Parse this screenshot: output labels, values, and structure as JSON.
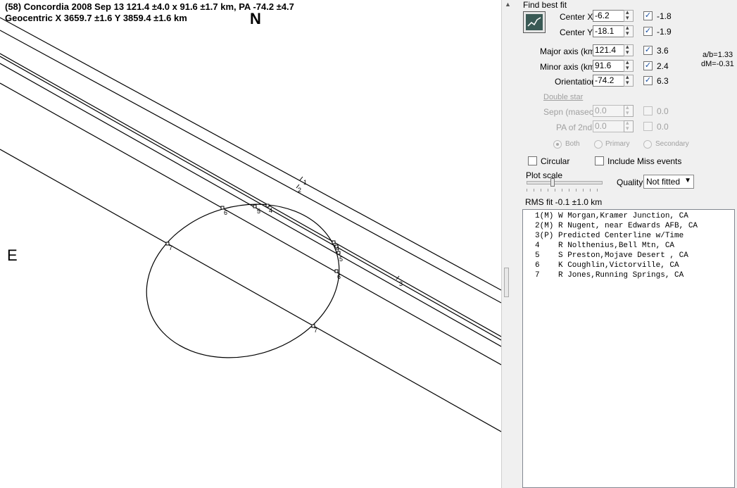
{
  "plot": {
    "title_line1": "(58) Concordia  2008 Sep 13   121.4 ±4.0 x 91.6 ±1.7 km, PA -74.2 ±4.7",
    "title_line2": "Geocentric  X  3659.7 ±1.6  Y 3859.4 ±1.6 km",
    "north_label": "N",
    "east_label": "E",
    "chord_labels": [
      "1",
      "2",
      "3",
      "4",
      "5",
      "6",
      "7"
    ]
  },
  "panel": {
    "group_title": "Find best fit",
    "center_x": {
      "label": "Center X",
      "value": "-6.2",
      "checked": true,
      "uncert": "-1.8"
    },
    "center_y": {
      "label": "Center Y",
      "value": "-18.1",
      "checked": true,
      "uncert": "-1.9"
    },
    "major": {
      "label": "Major axis (km)",
      "value": "121.4",
      "checked": true,
      "uncert": "3.6"
    },
    "minor": {
      "label": "Minor axis (km)",
      "value": "91.6",
      "checked": true,
      "uncert": "2.4"
    },
    "orient": {
      "label": "Orientation",
      "value": "-74.2",
      "checked": true,
      "uncert": "6.3"
    },
    "ratio": "a/b=1.33",
    "dm": "dM=-0.31",
    "double_star_link": "Double star",
    "sepn": {
      "label": "Sepn (masec)",
      "value": "0.0",
      "uncert": "0.0"
    },
    "pa2": {
      "label": "PA of 2nd",
      "value": "0.0",
      "uncert": "0.0"
    },
    "radio_both": "Both",
    "radio_primary": "Primary",
    "radio_secondary": "Secondary",
    "circular": "Circular",
    "include_miss": "Include Miss events",
    "plot_scale": "Plot scale",
    "quality_label": "Quality",
    "quality_value": "Not fitted",
    "rms": "RMS fit -0.1 ±1.0 km",
    "observers": [
      "1(M) W Morgan,Kramer Junction, CA",
      "2(M) R Nugent, near Edwards AFB, CA",
      "3(P) Predicted Centerline w/Time",
      "4    R Nolthenius,Bell Mtn, CA",
      "5    S Preston,Mojave Desert , CA",
      "6    K Coughlin,Victorville, CA",
      "7    R Jones,Running Springs, CA"
    ]
  }
}
